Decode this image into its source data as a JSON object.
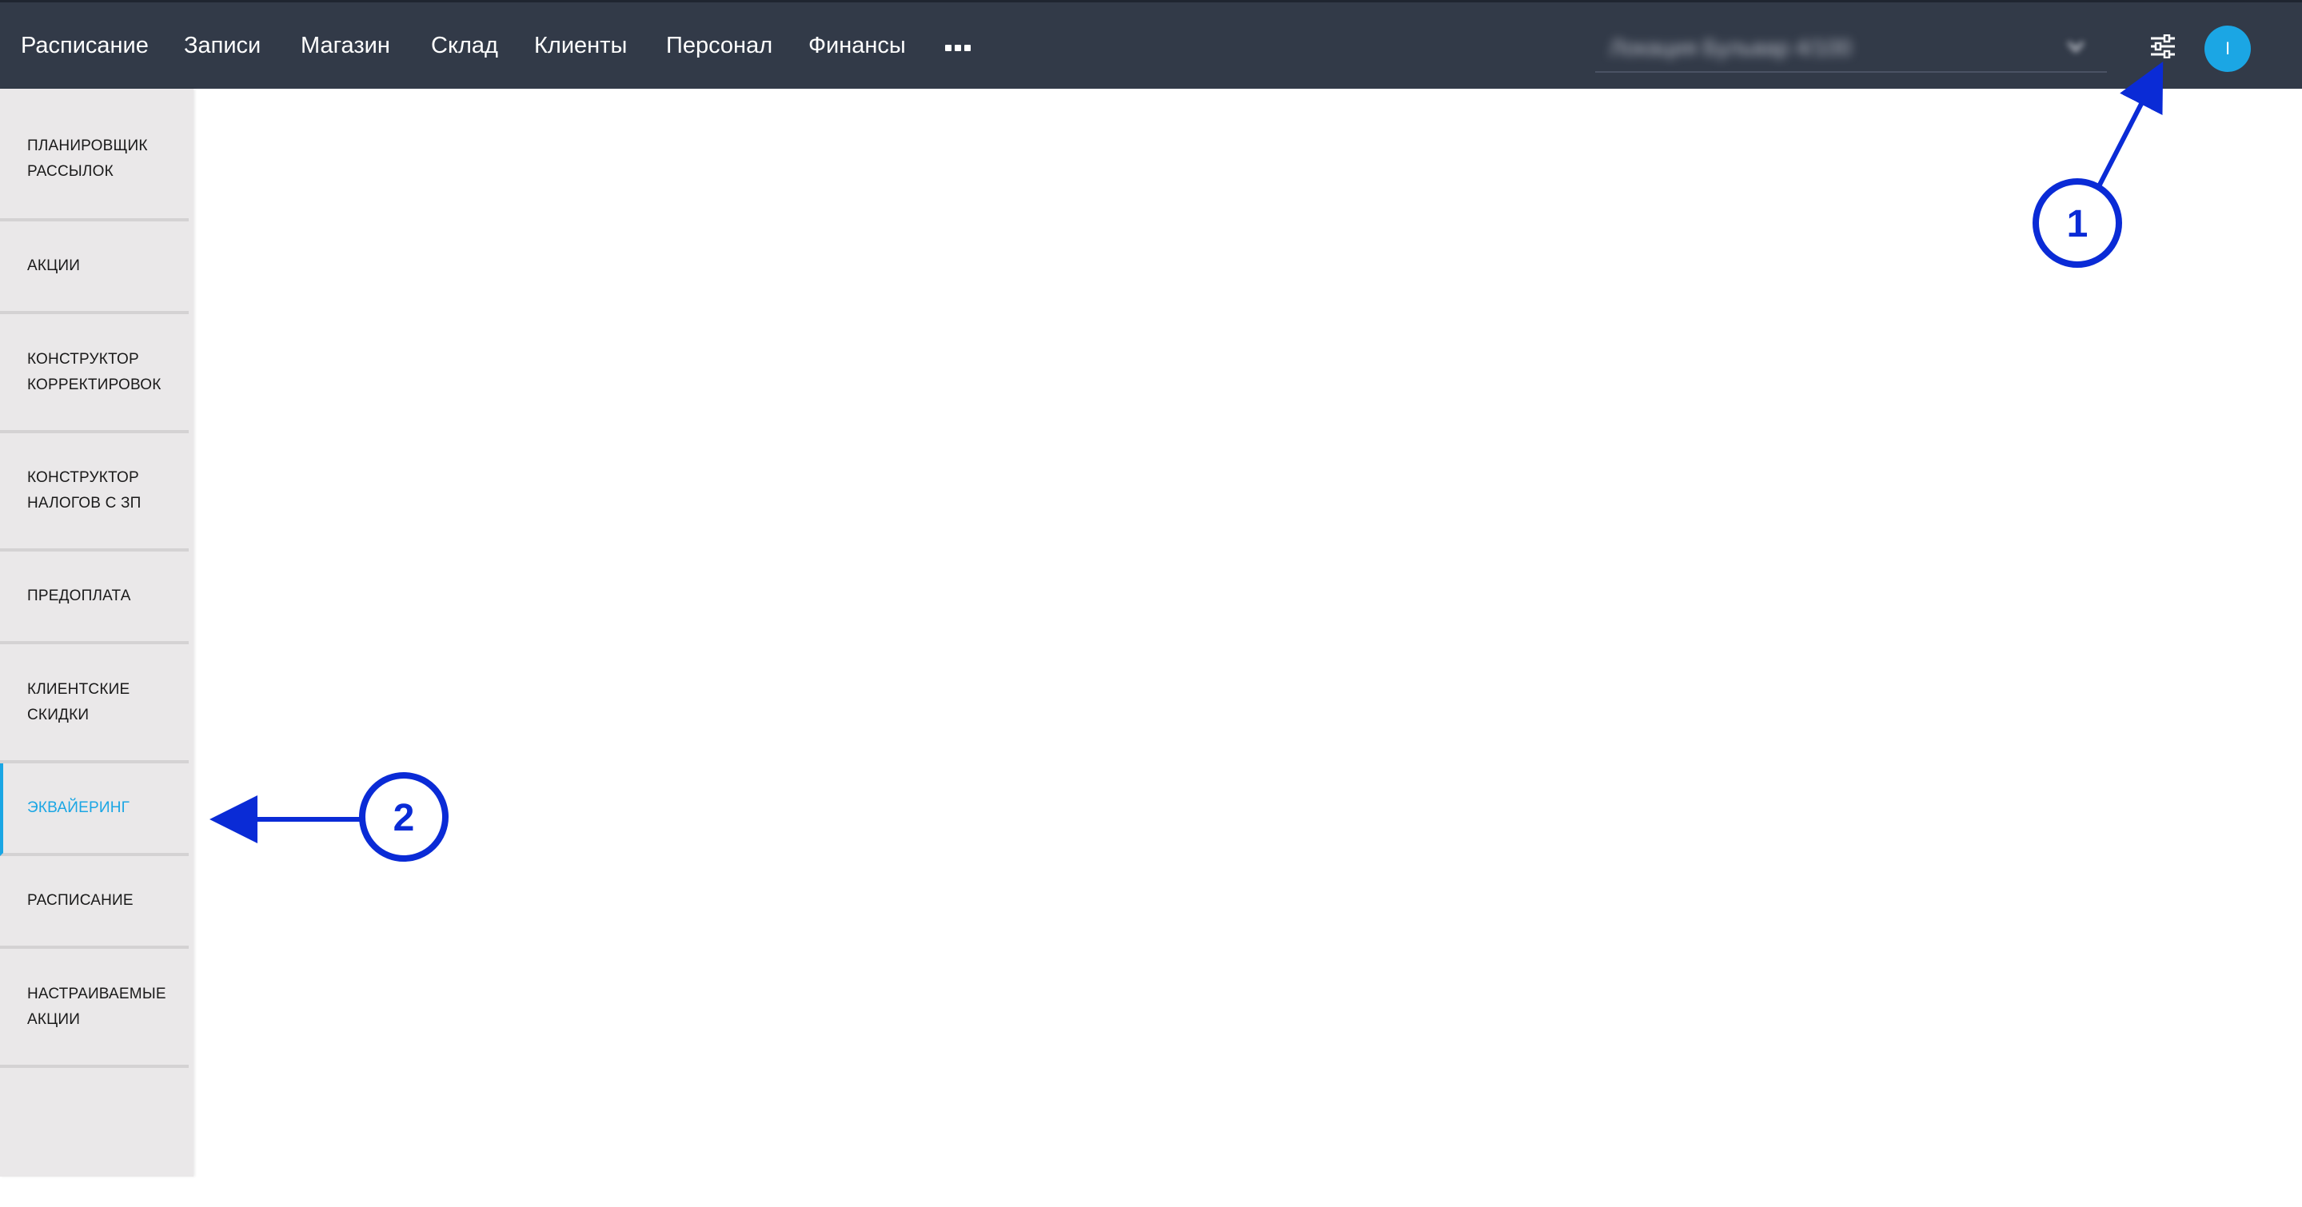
{
  "topnav": {
    "items": [
      {
        "label": "Расписание"
      },
      {
        "label": "Записи"
      },
      {
        "label": "Магазин"
      },
      {
        "label": "Склад"
      },
      {
        "label": "Клиенты"
      },
      {
        "label": "Персонал"
      },
      {
        "label": "Финансы"
      }
    ],
    "more_icon": "more-horizontal-icon",
    "location_select": {
      "value": "Локация Бульвар 4/100",
      "blurred": true,
      "icon": "chevron-down-icon"
    },
    "settings_icon": "sliders-icon",
    "avatar": {
      "initial": "I",
      "color": "#1ba6e4"
    }
  },
  "sidebar": {
    "items": [
      {
        "label": "Планировщик\nрассылок",
        "active": false
      },
      {
        "label": "Акции",
        "active": false
      },
      {
        "label": "Конструктор\nкорректировок",
        "active": false
      },
      {
        "label": "Конструктор\nналогов с ЗП",
        "active": false
      },
      {
        "label": "Предоплата",
        "active": false
      },
      {
        "label": "Клиентские\nскидки",
        "active": false
      },
      {
        "label": "Эквайеринг",
        "active": true
      },
      {
        "label": "Расписание",
        "active": false
      },
      {
        "label": "Настраиваемые\nакции",
        "active": false
      }
    ]
  },
  "annotations": [
    {
      "number": "1",
      "target": "settings-icon"
    },
    {
      "number": "2",
      "target": "sidebar-item-acquiring"
    }
  ],
  "colors": {
    "topbar": "#323a48",
    "sidebar": "#eae8e9",
    "accent": "#1ba6e4",
    "annotation": "#0a2bd6"
  }
}
